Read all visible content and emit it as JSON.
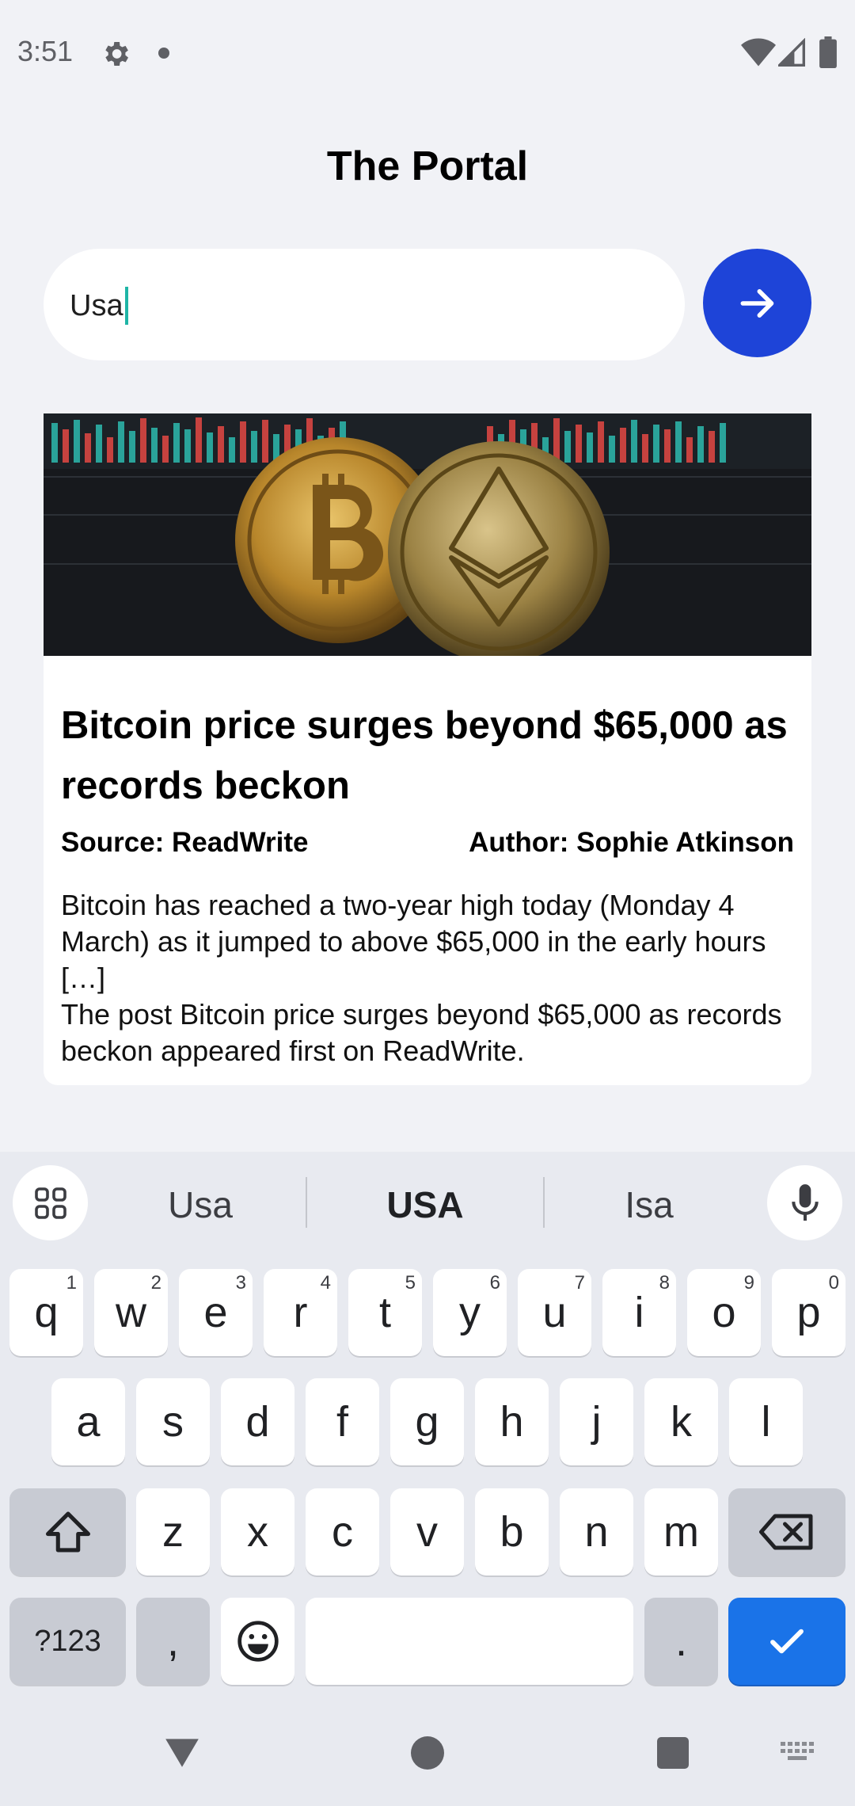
{
  "status_bar": {
    "time": "3:51",
    "icons": [
      "gear-icon",
      "notification-dot-icon",
      "wifi-icon",
      "signal-icon",
      "battery-icon"
    ]
  },
  "app": {
    "title": "The Portal"
  },
  "search": {
    "value": "Usa",
    "submit_icon": "arrow-right-icon"
  },
  "article": {
    "image_icon": "crypto-coins-image",
    "title": "Bitcoin price surges beyond $65,000 as records beckon",
    "source": "Source: ReadWrite",
    "author": "Author: Sophie Atkinson",
    "description": "Bitcoin has reached a two-year high today (Monday 4 March) as it jumped to above $65,000 in the early hours […]\nThe post Bitcoin price surges beyond $65,000 as records beckon appeared first on ReadWrite."
  },
  "keyboard": {
    "suggestions": [
      "Usa",
      "USA",
      "Isa"
    ],
    "row1": [
      "q",
      "w",
      "e",
      "r",
      "t",
      "y",
      "u",
      "i",
      "o",
      "p"
    ],
    "row1_hints": [
      "1",
      "2",
      "3",
      "4",
      "5",
      "6",
      "7",
      "8",
      "9",
      "0"
    ],
    "row2": [
      "a",
      "s",
      "d",
      "f",
      "g",
      "h",
      "j",
      "k",
      "l"
    ],
    "row3": [
      "z",
      "x",
      "c",
      "v",
      "b",
      "n",
      "m"
    ],
    "symbols_label": "?123",
    "comma": ",",
    "period": ".",
    "accent_color": "#1a73e8"
  },
  "colors": {
    "background": "#f1f2f6",
    "go_button": "#1e44d8",
    "caret": "#1fb5a6"
  }
}
